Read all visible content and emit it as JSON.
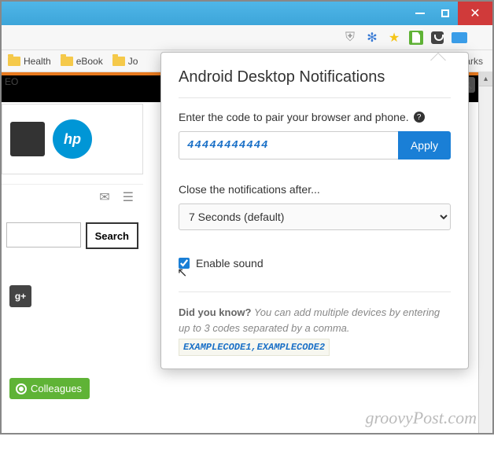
{
  "window": {
    "title": ""
  },
  "bookmarks": {
    "eo": "EO",
    "items": [
      "Health",
      "eBook",
      "Jo"
    ],
    "hidden": "narks"
  },
  "sidebar": {
    "hp": "hp",
    "search_btn": "Search",
    "gplus": "g+",
    "colleagues": "Colleagues"
  },
  "popup": {
    "title": "Android Desktop Notifications",
    "pair_label": "Enter the code to pair your browser and phone.",
    "code_value": "44444444444",
    "apply": "Apply",
    "close_label": "Close the notifications after...",
    "close_value": "7 Seconds (default)",
    "enable_sound": "Enable sound",
    "sound_checked": true,
    "dyk_title": "Did you know?",
    "dyk_text": "You can add multiple devices by entering up to 3 codes separated by a comma.",
    "example": "EXAMPLECODE1,EXAMPLECODE2"
  },
  "watermark": "groovyPost.com"
}
